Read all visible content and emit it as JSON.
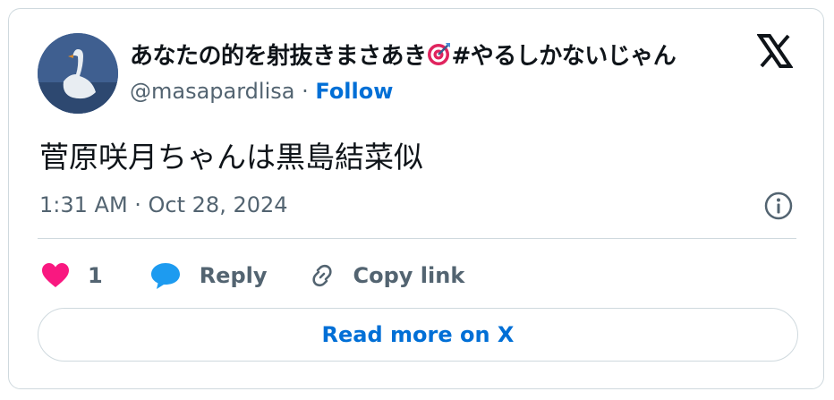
{
  "author": {
    "display_name": "あなたの的を射抜きまさあき",
    "display_name_suffix": "#やるしかないじゃん",
    "handle": "@masapardlisa",
    "separator": "·",
    "follow_label": "Follow"
  },
  "tweet": {
    "text": "菅原咲月ちゃんは黒島結菜似",
    "timestamp": "1:31 AM · Oct 28, 2024"
  },
  "actions": {
    "like_count": "1",
    "reply_label": "Reply",
    "copy_link_label": "Copy link"
  },
  "read_more_label": "Read more on X",
  "icons": [
    "swan-avatar",
    "target-emoji-icon",
    "x-logo-icon",
    "info-icon",
    "heart-icon",
    "reply-bubble-icon",
    "link-icon"
  ],
  "colors": {
    "accent": "#006fd6",
    "like": "#f91880",
    "reply_icon": "#1d9bf0",
    "muted_text": "#536471",
    "border": "#cfd9de"
  }
}
